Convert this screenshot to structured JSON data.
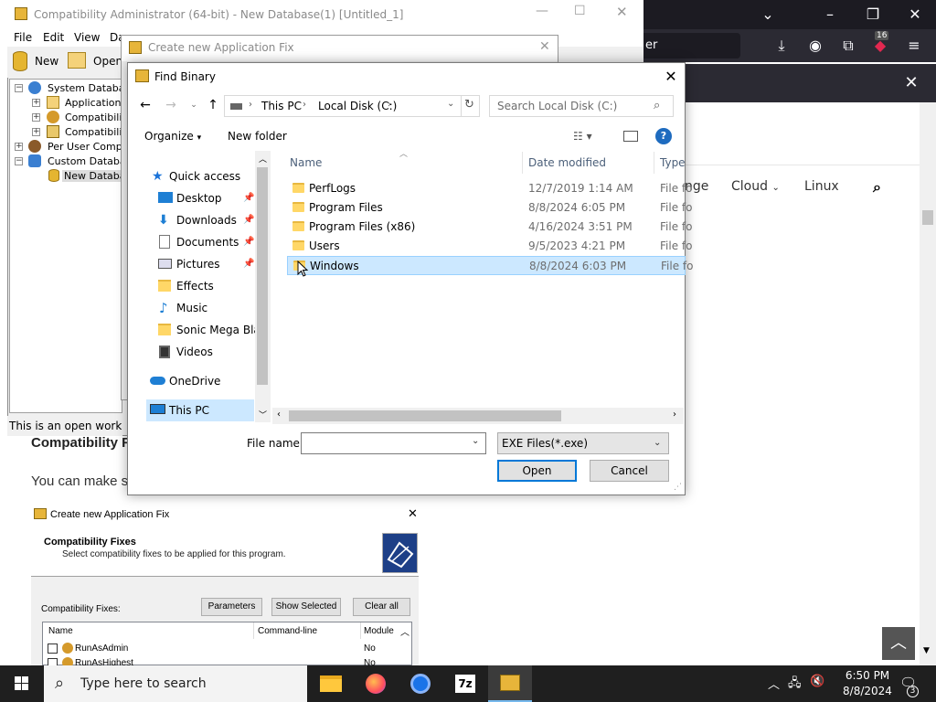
{
  "browser": {
    "url_fragment": "er",
    "extension_badge": "16",
    "nav_links": [
      "nge",
      "Cloud",
      "Linux"
    ],
    "article_heading": "Compatibility Fi",
    "article_paragraph": "You can make su",
    "back_to_top_icon": "chevron-up"
  },
  "article_image": {
    "title": "Create new Application Fix",
    "heading": "Compatibility Fixes",
    "subheading": "Select compatibility fixes to be applied for this program.",
    "label": "Compatibility Fixes:",
    "buttons": [
      "Parameters",
      "Show Selected",
      "Clear all"
    ],
    "columns": [
      "Name",
      "Command-line",
      "Module"
    ],
    "rows": [
      {
        "name": "RunAsAdmin",
        "module": "No"
      },
      {
        "name": "RunAsHighest",
        "module": "No"
      }
    ]
  },
  "ca_window": {
    "title": "Compatibility Administrator (64-bit) - New Database(1) [Untitled_1]",
    "menu": [
      "File",
      "Edit",
      "View",
      "Da"
    ],
    "toolbar": [
      "New",
      "Open"
    ],
    "tree": [
      "System Database",
      "Applications",
      "Compatibility",
      "Compatibility",
      "Per User Compat",
      "Custom Databas",
      "New Databas"
    ],
    "status": "This is an open working"
  },
  "cnaf_window": {
    "title": "Create new Application Fix"
  },
  "find_binary": {
    "title": "Find Binary",
    "breadcrumb": [
      "This PC",
      "Local Disk (C:)"
    ],
    "search_placeholder": "Search Local Disk (C:)",
    "organize": "Organize",
    "new_folder": "New folder",
    "nav_pane": {
      "quick_access": "Quick access",
      "items": [
        "Desktop",
        "Downloads",
        "Documents",
        "Pictures",
        "Effects",
        "Music",
        "Sonic Mega Blas",
        "Videos"
      ],
      "onedrive": "OneDrive",
      "this_pc": "This PC"
    },
    "columns": [
      "Name",
      "Date modified",
      "Type"
    ],
    "files": [
      {
        "name": "PerfLogs",
        "date": "12/7/2019 1:14 AM",
        "type": "File fo"
      },
      {
        "name": "Program Files",
        "date": "8/8/2024 6:05 PM",
        "type": "File fo"
      },
      {
        "name": "Program Files (x86)",
        "date": "4/16/2024 3:51 PM",
        "type": "File fo"
      },
      {
        "name": "Users",
        "date": "9/5/2023 4:21 PM",
        "type": "File fo"
      },
      {
        "name": "Windows",
        "date": "8/8/2024 6:03 PM",
        "type": "File fo"
      }
    ],
    "selected_file": "Windows",
    "file_name_label": "File name:",
    "file_name_value": "",
    "file_type": "EXE Files(*.exe)",
    "open_label": "Open",
    "cancel_label": "Cancel"
  },
  "taskbar": {
    "search_placeholder": "Type here to search",
    "time": "6:50 PM",
    "date": "8/8/2024",
    "notification_count": "3"
  },
  "colors": {
    "selection": "#cce8ff",
    "accent": "#0078d7",
    "browser_dark": "#2b2a33",
    "taskbar": "#1f1f1f"
  }
}
